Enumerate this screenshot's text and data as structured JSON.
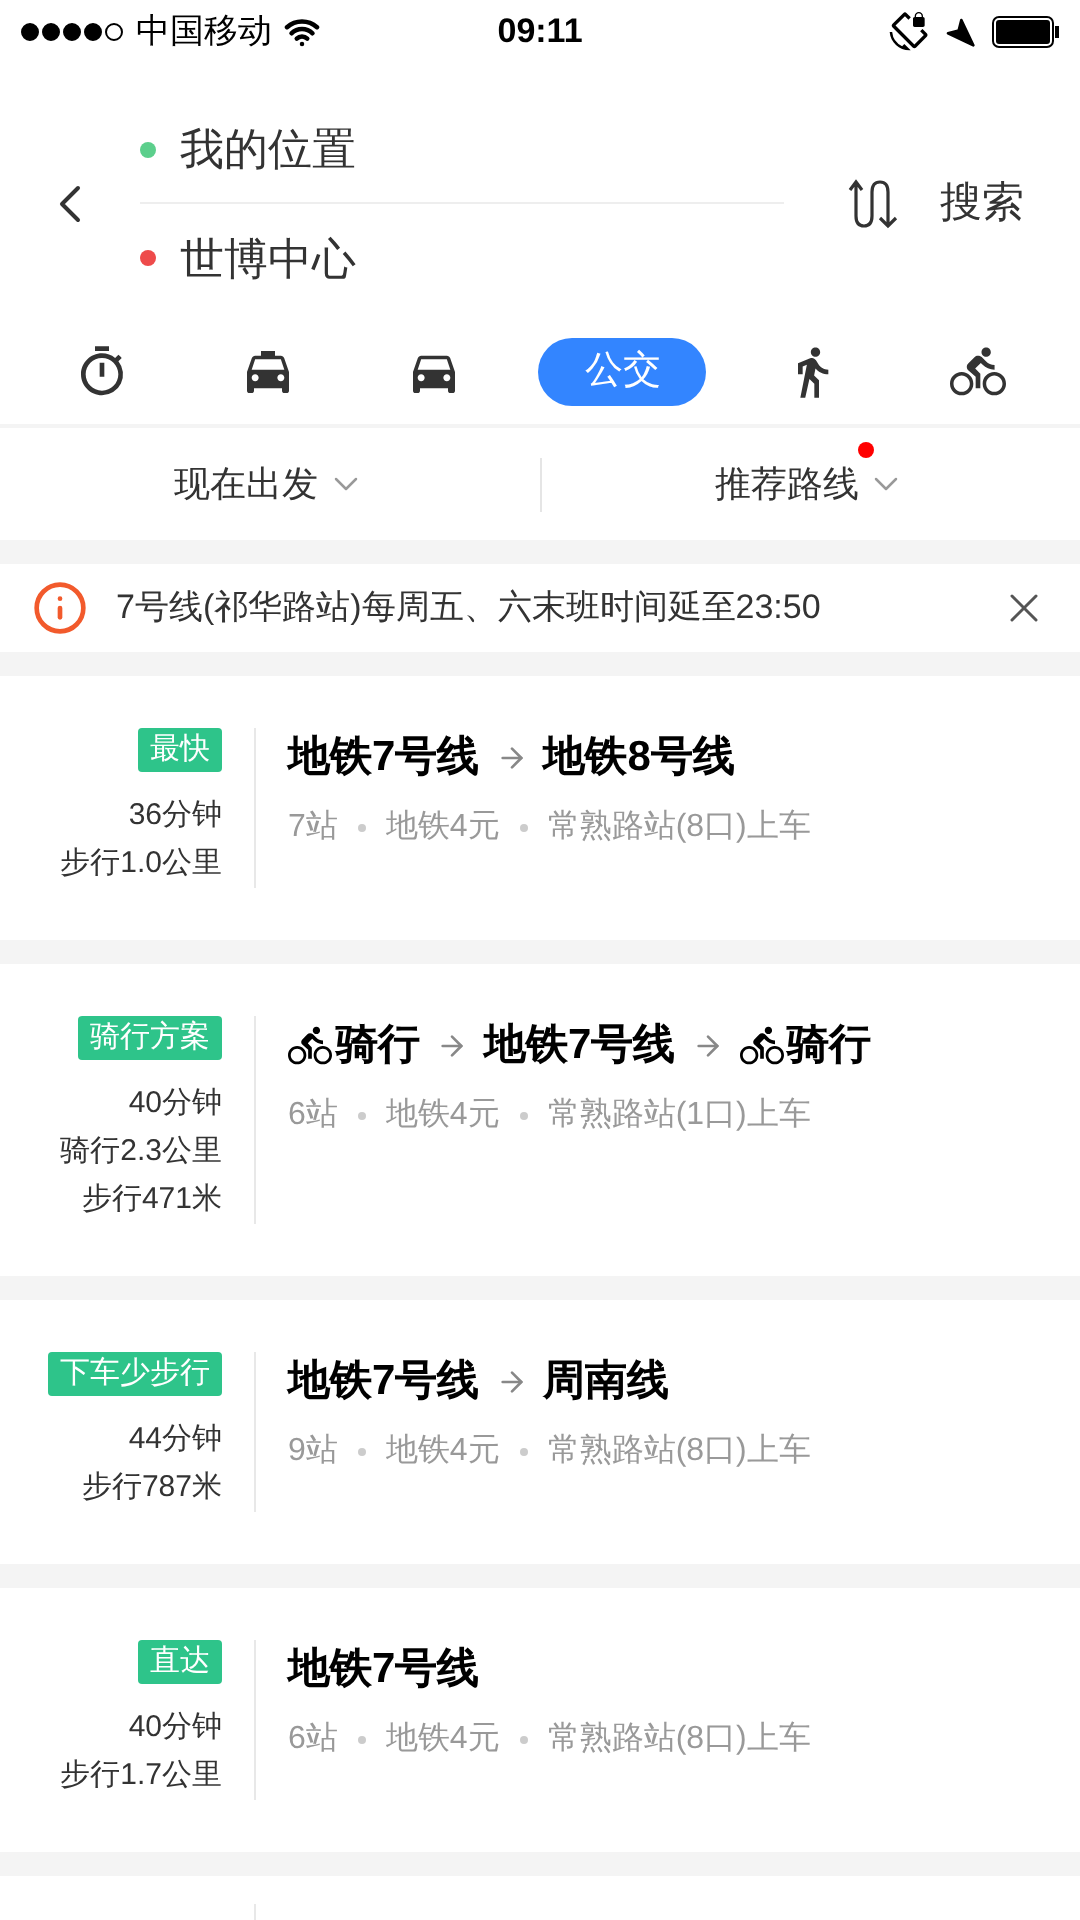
{
  "status_bar": {
    "carrier": "中国移动",
    "time": "09:11"
  },
  "places": [
    {
      "label": "我的位置",
      "color": "#5ccf8c"
    },
    {
      "label": "世博中心",
      "color": "#ee4b4b"
    }
  ],
  "search_button": "搜索",
  "modes": [
    {
      "kind": "timer",
      "selected": false
    },
    {
      "kind": "taxi",
      "selected": false
    },
    {
      "kind": "car",
      "selected": false
    },
    {
      "kind": "transit",
      "label": "公交",
      "selected": true
    },
    {
      "kind": "walk",
      "selected": false
    },
    {
      "kind": "bike",
      "selected": false
    }
  ],
  "filters": [
    {
      "label": "现在出发",
      "badge": false
    },
    {
      "label": "推荐路线",
      "badge": true
    }
  ],
  "notice": {
    "text": "7号线(祁华路站)每周五、六末班时间延至23:50"
  },
  "routes": [
    {
      "tag": "最快",
      "stats": [
        "36分钟",
        "步行1.0公里"
      ],
      "segments": [
        {
          "kind": "line",
          "label": "地铁7号线"
        },
        {
          "kind": "line",
          "label": "地铁8号线"
        }
      ],
      "details": [
        "7站",
        "地铁4元",
        "常熟路站(8口)上车"
      ]
    },
    {
      "tag": "骑行方案",
      "stats": [
        "40分钟",
        "骑行2.3公里",
        "步行471米"
      ],
      "segments": [
        {
          "kind": "bike",
          "label": "骑行"
        },
        {
          "kind": "line",
          "label": "地铁7号线"
        },
        {
          "kind": "bike",
          "label": "骑行"
        }
      ],
      "details": [
        "6站",
        "地铁4元",
        "常熟路站(1口)上车"
      ]
    },
    {
      "tag": "下车少步行",
      "stats": [
        "44分钟",
        "步行787米"
      ],
      "segments": [
        {
          "kind": "line",
          "label": "地铁7号线"
        },
        {
          "kind": "line",
          "label": "周南线"
        }
      ],
      "details": [
        "9站",
        "地铁4元",
        "常熟路站(8口)上车"
      ]
    },
    {
      "tag": "直达",
      "stats": [
        "40分钟",
        "步行1.7公里"
      ],
      "segments": [
        {
          "kind": "line",
          "label": "地铁7号线"
        }
      ],
      "details": [
        "6站",
        "地铁4元",
        "常熟路站(8口)上车"
      ]
    }
  ]
}
